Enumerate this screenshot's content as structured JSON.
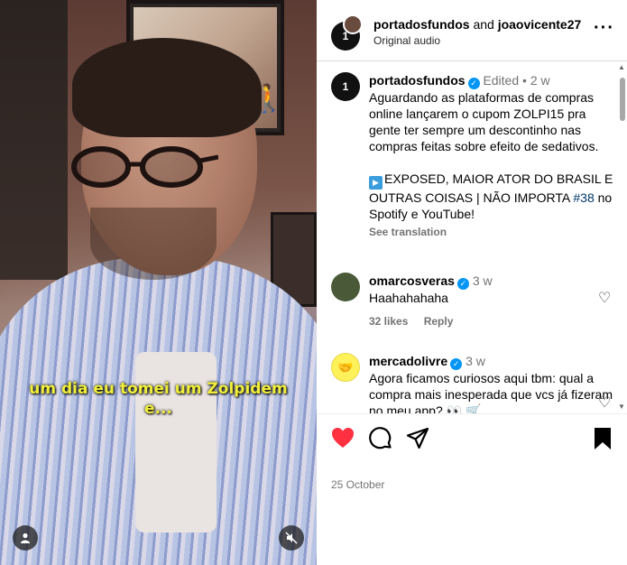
{
  "video": {
    "caption_line1": "um dia eu tomei um Zolpidem",
    "caption_line2": "e...",
    "user_icon": "user-icon",
    "mute_icon": "muted-speaker-icon"
  },
  "header": {
    "avatar_text": "1",
    "author": "portadosfundos",
    "and_text": "and",
    "coauthor": "joaovicente27",
    "audio": "Original audio",
    "more": "···"
  },
  "caption": {
    "avatar_text": "1",
    "username": "portadosfundos",
    "edited": "Edited",
    "dot": "•",
    "age": "2 w",
    "text": "Aguardando as plataformas de compras online lançarem o cupom ZOLPI15 pra gente ter sempre um descontinho nas compras feitas sobre efeito de sedativos.",
    "promo": "EXPOSED, MAIOR ATOR DO BRASIL E OUTRAS COISAS | NÃO IMPORTA",
    "hashtag": "#38",
    "promo_end": "no Spotify e YouTube!",
    "see_translation": "See translation"
  },
  "comments": [
    {
      "username": "omarcosveras",
      "age": "3 w",
      "text": "Haahahahaha",
      "likes": "32 likes",
      "reply": "Reply"
    },
    {
      "username": "mercadolivre",
      "age": "3 w",
      "text": "Agora ficamos curiosos aqui tbm: qual a compra mais inesperada que vcs já fizeram no meu app? 👀 🛒"
    }
  ],
  "footer": {
    "date": "25 October"
  },
  "colors": {
    "like_red": "#ff3040",
    "verified_blue": "#0095f6",
    "caption_yellow": "#f0ef3a"
  }
}
